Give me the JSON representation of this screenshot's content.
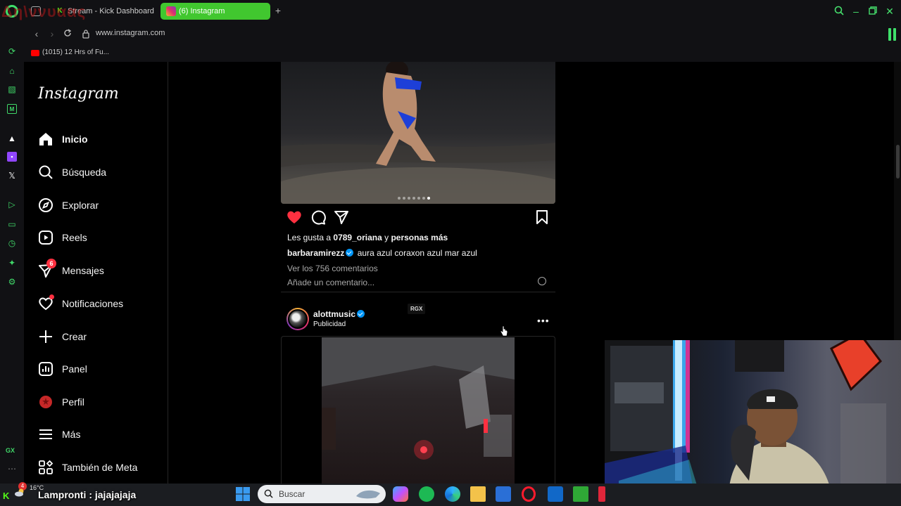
{
  "browser": {
    "tabs": [
      {
        "label": "Stream - Kick Dashboard",
        "favicon": "kick-icon",
        "active": false
      },
      {
        "label": "(6) Instagram",
        "favicon": "instagram-icon",
        "active": true
      }
    ],
    "url": "www.instagram.com",
    "bookmark": {
      "label": "(1015) 12 Hrs of Fu..."
    },
    "gx_label": "GX",
    "accent_color": "#3fe06a",
    "overlay_text": "Δη\\ννυαας"
  },
  "instagram": {
    "logo": "Instagram",
    "nav": [
      {
        "label": "Inicio",
        "icon": "home-icon",
        "active": true
      },
      {
        "label": "Búsqueda",
        "icon": "search-icon"
      },
      {
        "label": "Explorar",
        "icon": "compass-icon"
      },
      {
        "label": "Reels",
        "icon": "reels-icon"
      },
      {
        "label": "Mensajes",
        "icon": "messenger-icon",
        "badge": "6"
      },
      {
        "label": "Notificaciones",
        "icon": "heart-icon"
      },
      {
        "label": "Crear",
        "icon": "plus-icon"
      },
      {
        "label": "Panel",
        "icon": "dashboard-icon"
      },
      {
        "label": "Perfil",
        "icon": "profile-avatar-icon"
      },
      {
        "label": "Más",
        "icon": "menu-icon"
      },
      {
        "label": "También de Meta",
        "icon": "grid-icon"
      }
    ],
    "post1": {
      "likes_prefix": "Les gusta a ",
      "likes_user": "0789_oriana",
      "likes_suffix": " y ",
      "likes_others": "personas más",
      "author": "barbaramirezz",
      "caption": "aura azul coraxon azul mar azul",
      "view_comments": "Ver los 756 comentarios",
      "add_comment_placeholder": "Añade un comentario...",
      "carousel_total": 7,
      "carousel_current": 7
    },
    "post2": {
      "author": "alottmusic",
      "sponsored_label": "Publicidad",
      "tag": "RGX"
    }
  },
  "taskbar": {
    "weather": "16°C",
    "notification_count": "4",
    "chat_message": "Lampronti : jajajajaja",
    "search_placeholder": "Buscar"
  }
}
